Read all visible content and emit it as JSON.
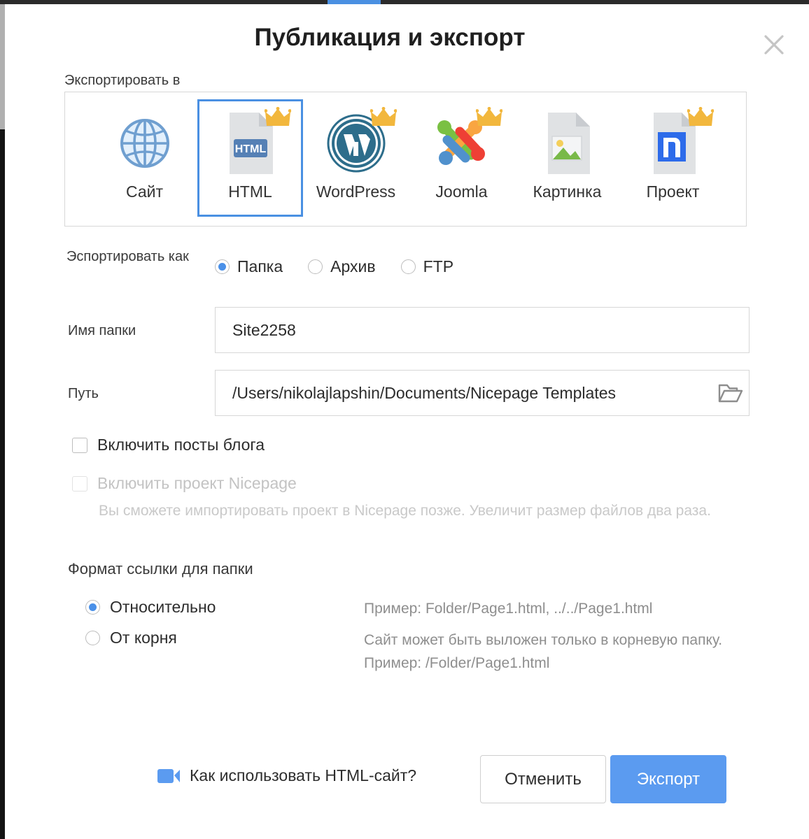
{
  "dialog": {
    "title": "Публикация и экспорт",
    "close_icon": "close-icon"
  },
  "export_to": {
    "label": "Экспортировать в",
    "targets": [
      {
        "label": "Сайт",
        "icon": "globe-icon",
        "pro": false,
        "selected": false
      },
      {
        "label": "HTML",
        "icon": "html-file-icon",
        "pro": true,
        "selected": true
      },
      {
        "label": "WordPress",
        "icon": "wordpress-icon",
        "pro": true,
        "selected": false
      },
      {
        "label": "Joomla",
        "icon": "joomla-icon",
        "pro": true,
        "selected": false
      },
      {
        "label": "Картинка",
        "icon": "image-file-icon",
        "pro": false,
        "selected": false
      },
      {
        "label": "Проект",
        "icon": "nicepage-file-icon",
        "pro": true,
        "selected": false
      }
    ],
    "html_badge_text": "HTML",
    "crown_icon": "crown-icon"
  },
  "export_as": {
    "label": "Эспортировать как",
    "options": [
      {
        "label": "Папка",
        "selected": true
      },
      {
        "label": "Архив",
        "selected": false
      },
      {
        "label": "FTP",
        "selected": false
      }
    ]
  },
  "folder_name": {
    "label": "Имя папки",
    "value": "Site2258"
  },
  "path": {
    "label": "Путь",
    "value": "/Users/nikolajlapshin/Documents/Nicepage Templates",
    "browse_icon": "open-folder-icon"
  },
  "checkboxes": {
    "blog": {
      "label": "Включить посты блога",
      "checked": false,
      "disabled": false
    },
    "project": {
      "label": "Включить проект Nicepage",
      "checked": false,
      "disabled": true,
      "description": "Вы сможете импортировать проект в Nicepage позже. Увеличит размер файлов два раза."
    }
  },
  "link_format": {
    "title": "Формат ссылки для папки",
    "options": [
      {
        "label": "Относительно",
        "selected": true,
        "note": "Пример: Folder/Page1.html, ../../Page1.html"
      },
      {
        "label": "От корня",
        "selected": false,
        "note": "Сайт может быть выложен только в корневую папку.\nПример: /Folder/Page1.html"
      }
    ]
  },
  "footer": {
    "help_label": "Как использовать HTML-сайт?",
    "help_icon": "video-camera-icon",
    "cancel_label": "Отменить",
    "export_label": "Экспорт"
  },
  "colors": {
    "accent": "#4a90e2",
    "primary_button": "#5b9bf0",
    "crown": "#f2b73d",
    "muted_text": "#8e8e8e",
    "disabled_text": "#c3c3c3"
  }
}
